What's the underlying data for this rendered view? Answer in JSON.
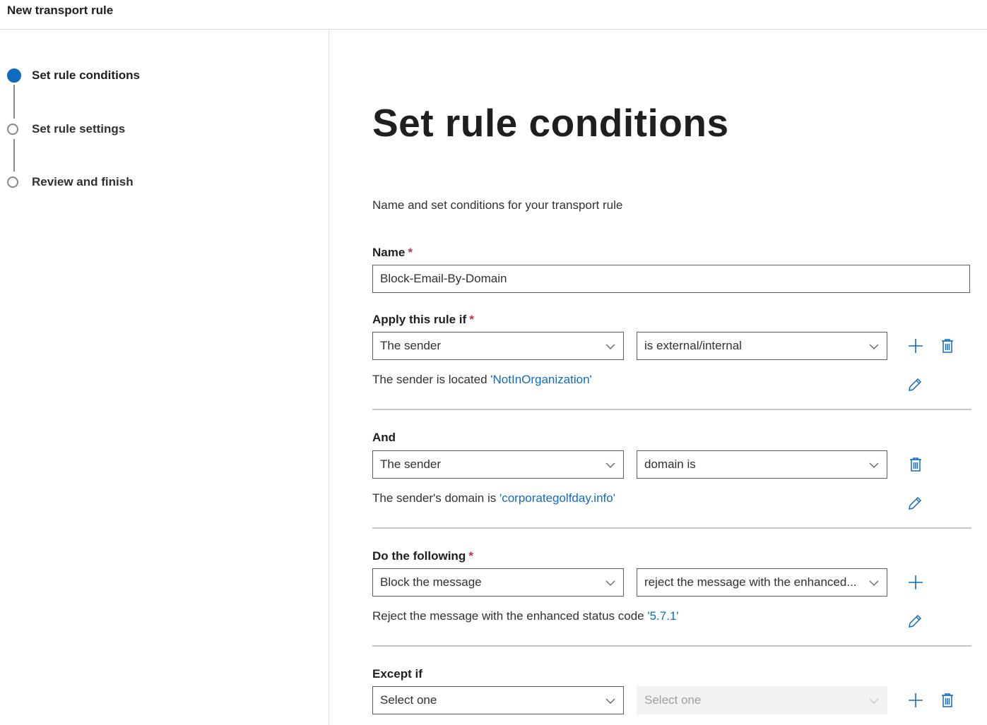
{
  "header": {
    "title": "New transport rule"
  },
  "steps": [
    {
      "label": "Set rule conditions",
      "state": "active"
    },
    {
      "label": "Set rule settings",
      "state": "pending"
    },
    {
      "label": "Review and finish",
      "state": "pending"
    }
  ],
  "main": {
    "heading": "Set rule conditions",
    "subtitle": "Name and set conditions for your transport rule",
    "name_label": "Name",
    "required_mark": "*",
    "name_value": "Block-Email-By-Domain",
    "apply": {
      "label": "Apply this rule if",
      "dropdown1": "The sender",
      "dropdown2": "is external/internal",
      "desc_text": "The sender is located ",
      "desc_link": "'NotInOrganization'"
    },
    "and": {
      "label": "And",
      "dropdown1": "The sender",
      "dropdown2": "domain is",
      "desc_text": "The sender's domain is ",
      "desc_link": "'corporategolfday.info'"
    },
    "do": {
      "label": "Do the following",
      "dropdown1": "Block the message",
      "dropdown2": "reject the message with the enhanced...",
      "desc_text": "Reject the message with the enhanced status code ",
      "desc_link": "'5.7.1'"
    },
    "except": {
      "label": "Except if",
      "dropdown1": "Select one",
      "dropdown2": "Select one"
    }
  },
  "colors": {
    "accent": "#0f6cbd",
    "required": "#c4314b",
    "text": "#323130"
  },
  "icons": [
    "chevron-down-icon",
    "add-icon",
    "delete-icon",
    "edit-icon"
  ]
}
